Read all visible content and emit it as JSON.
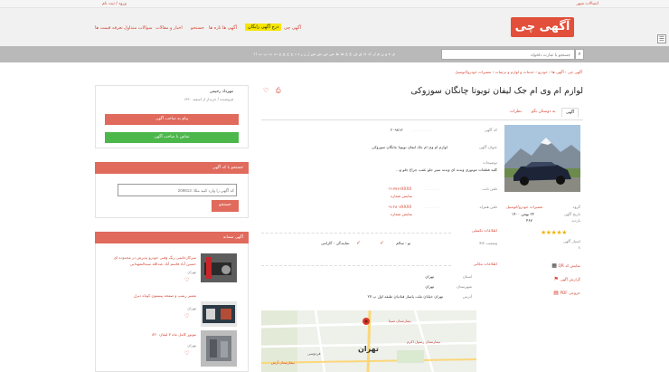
{
  "topbar": {
    "account_label": "ورود / ثبت نام",
    "register_label": "اتصالات شهر"
  },
  "brand": {
    "logo_text": "آگهی چی"
  },
  "nav": {
    "items": [
      "آگهی چی",
      "آگهی ها",
      "تازه ها",
      "جستجو",
      "اخبار و مقالات",
      "سوالات متداول",
      "تعرفه قیمت ها"
    ],
    "cta": "درج آگهی رایگان"
  },
  "alphabet": "ی ه و ن م ل گ ک ق ف غ ع ظ ط ض ص ش س ژ ز ر ذ د خ ح چ ج ث ت پ ب ا آ",
  "search": {
    "placeholder": "جستجو با عبارت دلخواه"
  },
  "breadcrumb": [
    "آگهی چی",
    "آگهی ها",
    "خودرو",
    "خدمات و لوازم و تزئینات",
    "تعمیرات خودرو/اتومبیل"
  ],
  "ad": {
    "title": "لوازم ام وی ام جک لیفان تویوتا چانگان سوزوکی",
    "tabs": [
      "آگهی",
      "به دوستان بگو",
      "نظرات"
    ],
    "fields": [
      {
        "label": "کد آگهی",
        "value": "۲۰۹۸۱۳"
      },
      {
        "label": "عنوان آگهی",
        "value": "لوازم ام وی ام جک لیفان تویوتا چانگان سوزوکی"
      },
      {
        "label": "توضیحات",
        "value": "کلیه قطعات موتوری وبدنه ای وبدنه سپر جلو عقب چراغ جلو و..."
      },
      {
        "label": "تلفن ثابت",
        "value": "۰۲۱۷۷۶۶XXXX",
        "link": "نمایش شماره"
      },
      {
        "label": "تلفن همراه",
        "value": "۰۹۱۲۸۰۷XXXX",
        "link": "نمایش شماره"
      }
    ],
    "extra_title": "اطلاعات تکمیلی",
    "extra": [
      {
        "label": "وضعیت کالا",
        "value": "نو - سالم"
      },
      {
        "label": "",
        "value": "نمایندگی - گارانتی"
      }
    ],
    "location_title": "اطلاعات مکانی",
    "location": [
      {
        "label": "استان",
        "value": "تهران"
      },
      {
        "label": "شهرستان",
        "value": "تهران"
      },
      {
        "label": "آدرس",
        "value": "تهران خیابان ملت پاساژ قنادیان طبقه اول پ ۲۷"
      }
    ],
    "map_labels": [
      "تهران",
      "بیمارستان سینا",
      "فردوسی",
      "بیمارستان رسول اکرم",
      "بیمارستان آرش"
    ]
  },
  "sidebar": {
    "category_label": "گروه",
    "category_value": "تعمیرات خودرو/اتومبیل",
    "date_label": "تاریخ آگهی",
    "date_value": "۲۴ بهمن ۱۴۰۰",
    "views_label": "بازدید",
    "views_value": "۴۶۷",
    "rating_label": "امتیاز آگهی",
    "rating_value": "۱",
    "qr_label": "نمایش کد QR",
    "report_label": "گزارش آگهی",
    "pdf_label": "خروجی PDF"
  },
  "user": {
    "name": "مهرداد رحیمی",
    "joined": "فروشنده / خریدار از اسفند ۱۳۹۰",
    "msg_button": "پیام به صاحب آگهی",
    "call_button": "تماس با صاحب آگهی"
  },
  "code_search": {
    "title": "جستجو با کد آگهی",
    "placeholder": "کد آگهی را وارد کنید مثلا: 209813",
    "button": "جستجو"
  },
  "similar": {
    "title": "آگهی مشابه",
    "items": [
      {
        "title": "سرکارخانمی رنگ وفنی خودرو پذیرش در محدوده ای حسین آباد قاسم آباد عبدالله سیدالشهدایی",
        "city": "تهران"
      },
      {
        "title": "تعمیر ریمپ و صفحه پیستون کوتاه دیزل",
        "city": "تهران"
      },
      {
        "title": "موتور کامل ماه ۷ لیفان ۸۲۰",
        "city": "تهران"
      }
    ]
  },
  "colors": {
    "accent": "#d34836",
    "header_bg": "#f1f1f1",
    "search_bg": "#b9b9b9",
    "green": "#4cb84b"
  }
}
